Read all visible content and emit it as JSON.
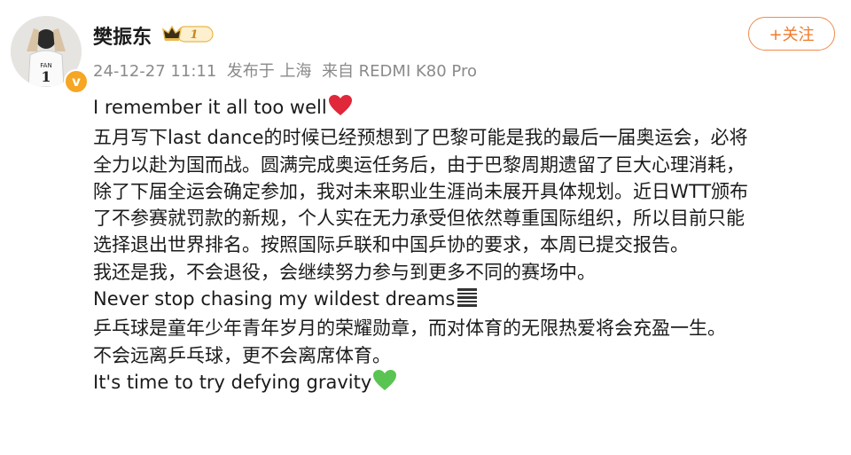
{
  "post": {
    "author": "樊振东",
    "vip_level": "1",
    "avatar_jersey_name": "FAN",
    "avatar_jersey_number": "1",
    "verified_mark": "v",
    "timestamp": "24-12-27 11:11",
    "published_label": "发布于 上海",
    "source": "来自 REDMI K80 Pro",
    "follow_label": "+关注",
    "lines": [
      "I remember it all too well",
      "五月写下last dance的时候已经预想到了巴黎可能是我的最后一届奥运会，必将",
      "全力以赴为国而战。圆满完成奥运任务后，由于巴黎周期遗留了巨大心理消耗，",
      "除了下届全运会确定参加，我对未来职业生涯尚未展开具体规划。近日WTT颁布",
      "了不参赛就罚款的新规，个人实在无力承受但依然尊重国际组织，所以目前只能",
      "选择退出世界排名。按照国际乒联和中国乒协的要求，本周已提交报告。",
      "我还是我，不会退役，会继续努力参与到更多不同的赛场中。",
      "Never stop chasing my wildest dreams",
      "乒乓球是童年少年青年岁月的荣耀勋章，而对体育的无限热爱将会充盈一生。",
      "不会远离乒乓球，更不会离席体育。",
      "It's time to try defying gravity"
    ],
    "icons": {
      "line0": "red-heart-icon",
      "line7": "bars-icon",
      "line10": "green-heart-icon"
    },
    "colors": {
      "accent": "#f07a2a",
      "meta_text": "#8a8a8a",
      "badge": "#f6a623",
      "red_heart": "#e0283a",
      "green_heart": "#5ac452"
    }
  }
}
